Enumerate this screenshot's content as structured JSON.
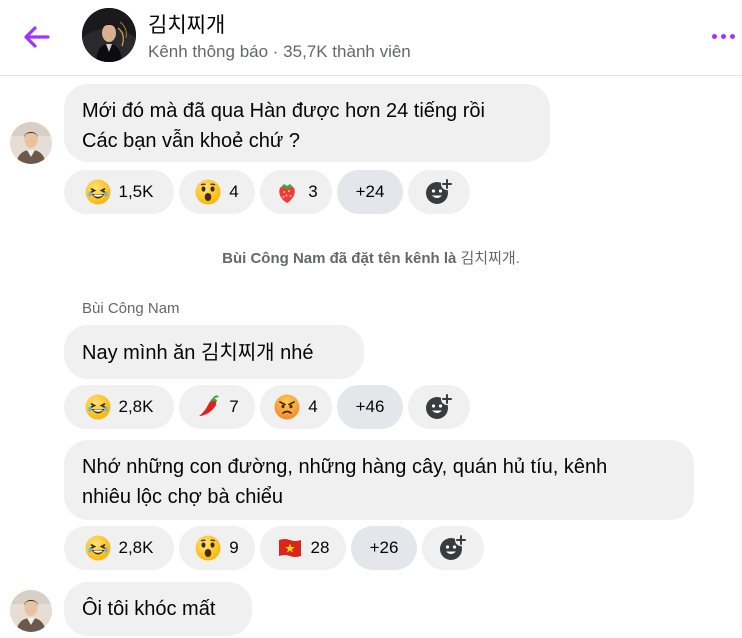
{
  "header": {
    "channel_name": "김치찌개",
    "channel_sub": "Kênh thông báo · 35,7K thành viên"
  },
  "messages": [
    {
      "lines": [
        "Mới đó mà đã qua Hàn được hơn 24 tiếng rồi",
        "Các bạn vẫn khoẻ chứ ?"
      ],
      "reactions": [
        {
          "emoji": "laugh",
          "count": "1,5K"
        },
        {
          "emoji": "wow",
          "count": "4"
        },
        {
          "emoji": "strawberry",
          "count": "3"
        }
      ],
      "more": "+24"
    },
    {
      "sender": "Bùi Công Nam",
      "text_prefix": "Nay mình ăn ",
      "text_korean": "김치찌개",
      "text_suffix": " nhé",
      "reactions": [
        {
          "emoji": "laugh",
          "count": "2,8K"
        },
        {
          "emoji": "chili",
          "count": "7"
        },
        {
          "emoji": "angry",
          "count": "4"
        }
      ],
      "more": "+46"
    },
    {
      "lines": [
        "Nhớ những con đường, những hàng cây, quán hủ tíu, kênh",
        "nhiêu lộc chợ bà chiểu"
      ],
      "reactions": [
        {
          "emoji": "laugh",
          "count": "2,8K"
        },
        {
          "emoji": "wow",
          "count": "9"
        },
        {
          "emoji": "vietnam-flag",
          "count": "28"
        }
      ],
      "more": "+26"
    },
    {
      "lines": [
        "Ôi tôi khóc mất"
      ]
    }
  ],
  "system": {
    "actor": "Bùi Công Nam",
    "action": " đã đặt tên kênh là ",
    "name": "김치찌개",
    "end": "."
  },
  "colors": {
    "accent": "#a033ff",
    "bubble": "#f0f0f0",
    "more_pill": "#e4e6eb",
    "secondary_text": "#65676b"
  },
  "icons": {
    "back": "arrow-left-icon",
    "more": "more-dots-icon",
    "add_reaction": "add-reaction-icon"
  }
}
